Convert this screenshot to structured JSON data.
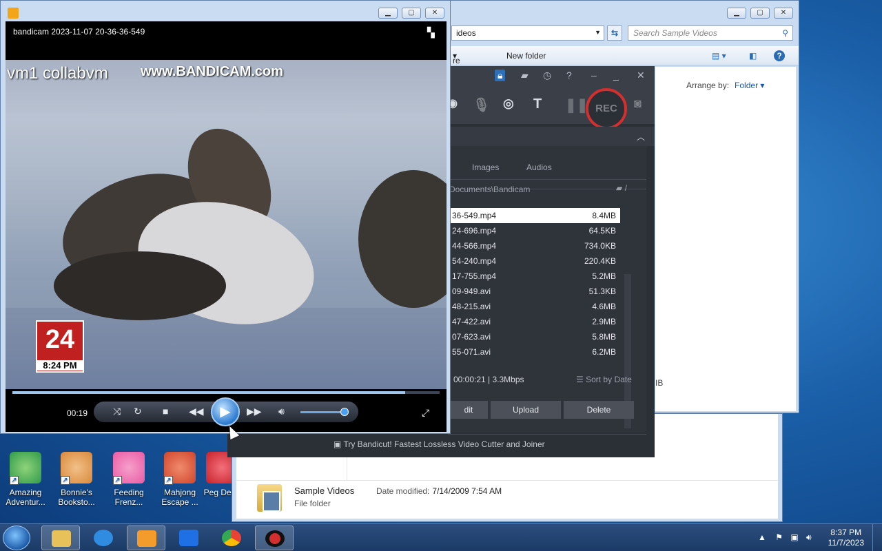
{
  "desktop_icons": [
    {
      "label": "Amazing Adventur...",
      "icon": "compass-icon",
      "color": "#2f9a4a"
    },
    {
      "label": "Bonnie's Booksto...",
      "icon": "bonnie-icon",
      "color": "#d9893a"
    },
    {
      "label": "Feeding Frenz...",
      "icon": "fish-icon",
      "color": "#e95aa4"
    },
    {
      "label": "Mahjong Escape ...",
      "icon": "gate-icon",
      "color": "#d0452b"
    },
    {
      "label": "Peg Del...",
      "icon": "peggle-icon",
      "color": "#c81f2a"
    }
  ],
  "explorer": {
    "address": "ideos",
    "search_placeholder": "Search Sample Videos",
    "cmd_share": "re with",
    "cmd_new_folder": "New folder",
    "arrange_by_label": "Arrange by:",
    "arrange_by_value": "Folder",
    "partial_text": "IB"
  },
  "lower_explorer": {
    "item_name": "Sample Videos",
    "date_label": "Date modified:",
    "date_value": "7/14/2009 7:54 AM",
    "item_type": "File folder"
  },
  "bandicam": {
    "rec_label": "REC",
    "tabs": [
      "Images",
      "Audios"
    ],
    "path": "Documents\\Bandicam",
    "files": [
      {
        "name": "36-549.mp4",
        "size": "8.4MB",
        "selected": true
      },
      {
        "name": "24-696.mp4",
        "size": "64.5KB"
      },
      {
        "name": "44-566.mp4",
        "size": "734.0KB"
      },
      {
        "name": "54-240.mp4",
        "size": "220.4KB"
      },
      {
        "name": "17-755.mp4",
        "size": "5.2MB"
      },
      {
        "name": "09-949.avi",
        "size": "51.3KB"
      },
      {
        "name": "48-215.avi",
        "size": "4.6MB"
      },
      {
        "name": "47-422.avi",
        "size": "2.9MB"
      },
      {
        "name": "07-623.avi",
        "size": "5.8MB"
      },
      {
        "name": "55-071.avi",
        "size": "6.2MB"
      }
    ],
    "status": "00:00:21 | 3.3Mbps",
    "sort_label": "Sort by Date",
    "buttons": {
      "edit": "dit",
      "upload": "Upload",
      "delete": "Delete"
    },
    "tip": "Try Bandicut! Fastest Lossless Video Cutter and Joiner"
  },
  "player": {
    "title": "bandicam 2023-11-07 20-36-36-549",
    "watermark_left": "vm1 collabvm",
    "watermark_right": "www.BANDICAM.com",
    "channel_logo": "24",
    "channel_time": "8:24 PM",
    "elapsed": "00:19",
    "progress": 0.92,
    "volume": 0.9
  },
  "taskbar": {
    "time": "8:37 PM",
    "date": "11/7/2023",
    "apps": [
      {
        "name": "explorer-task",
        "color": "#e8c15a",
        "active": true
      },
      {
        "name": "ie-task",
        "color": "#2f8ce0",
        "active": false
      },
      {
        "name": "media-player-task",
        "color": "#f39c2c",
        "active": true
      },
      {
        "name": "dropbox-task",
        "color": "#1f6fe5",
        "active": false
      },
      {
        "name": "chrome-task",
        "color": "#34a853",
        "active": false
      },
      {
        "name": "bandicam-task",
        "color": "#d32f2f",
        "active": true
      }
    ]
  }
}
